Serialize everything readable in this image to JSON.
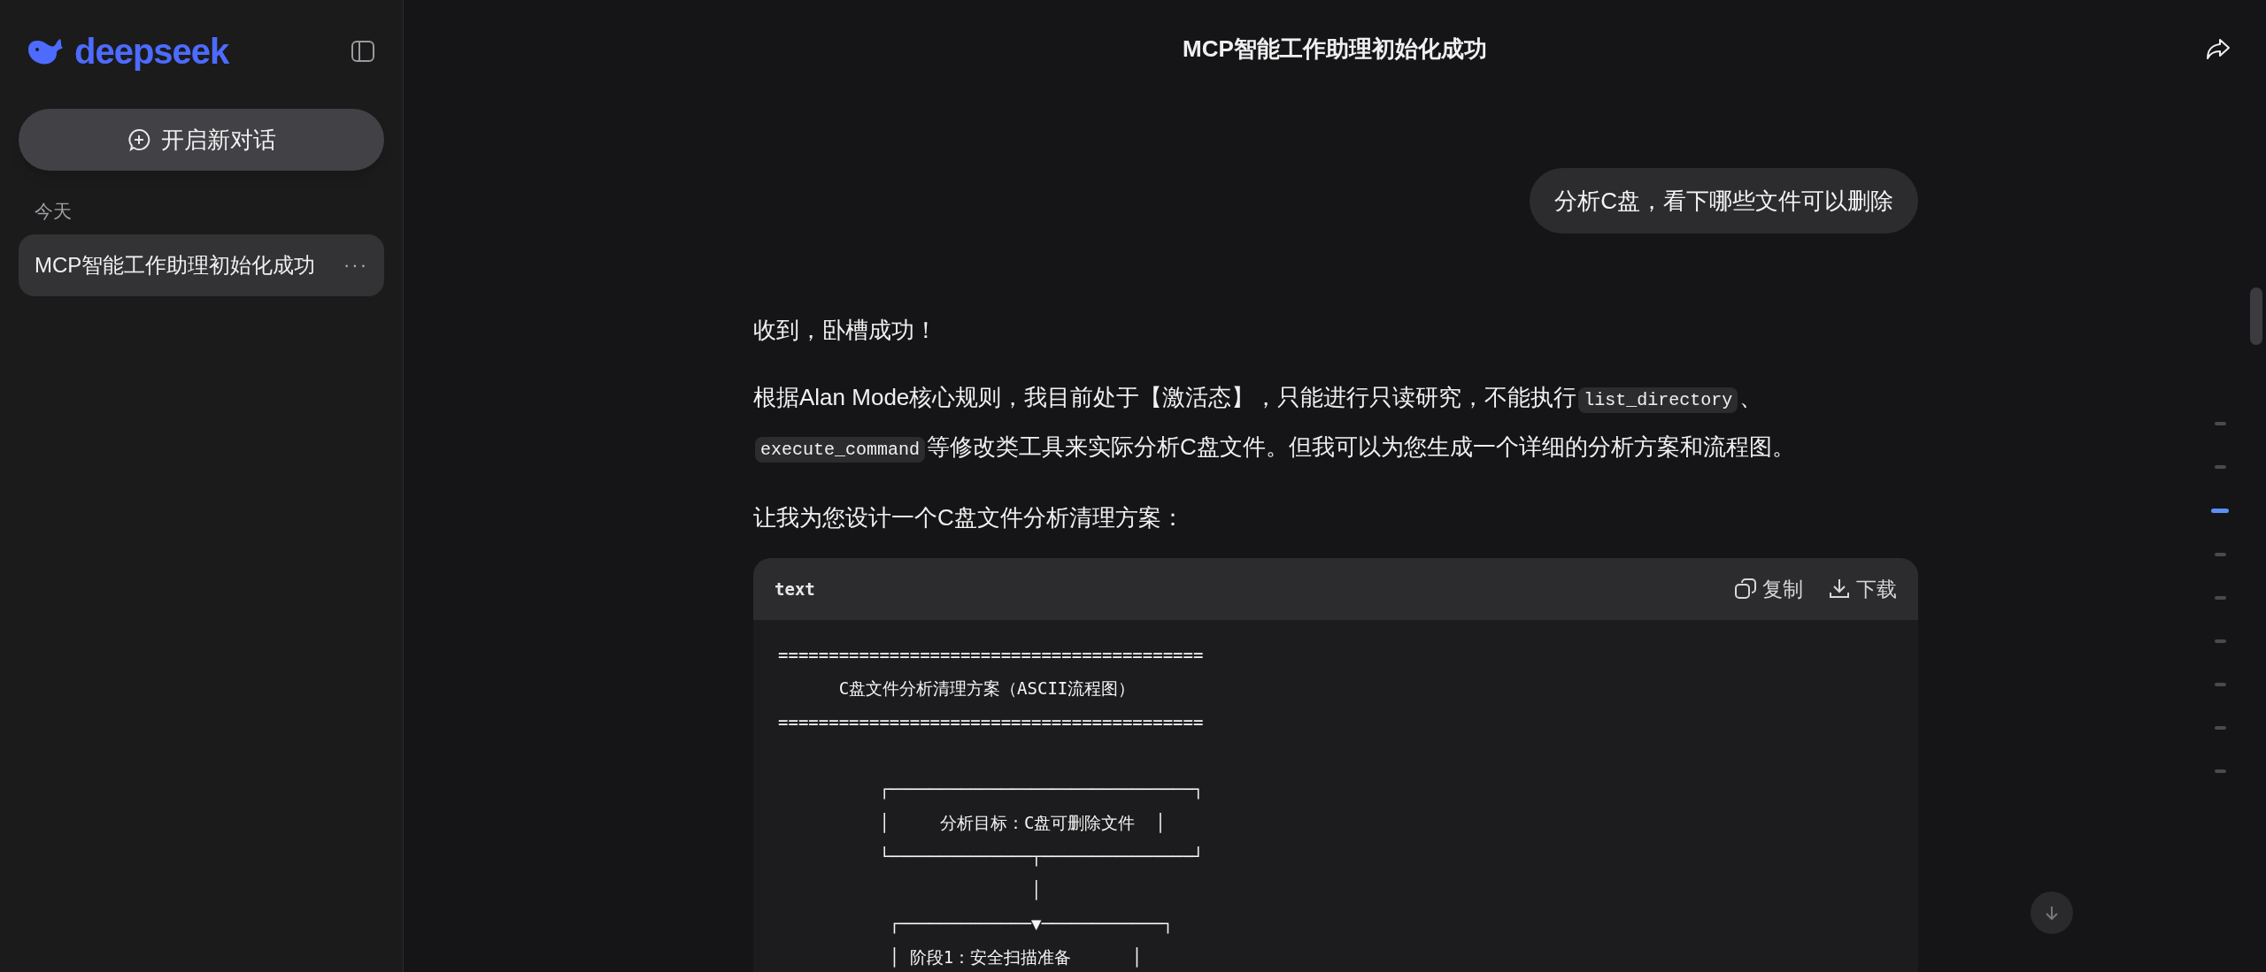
{
  "sidebar": {
    "logo": "deepseek",
    "new_chat_button": "开启新对话",
    "sections": [
      {
        "heading": "今天",
        "items": [
          {
            "title": "MCP智能工作助理初始化成功",
            "more": "···",
            "selected": true
          }
        ]
      }
    ]
  },
  "header": {
    "title": "MCP智能工作助理初始化成功"
  },
  "messages": [
    {
      "kind": "user",
      "text": "分析C盘，看下哪些文件可以删除"
    },
    {
      "kind": "assistant",
      "blocks": [
        {
          "kind": "paragraph",
          "parts": [
            {
              "kind": "text",
              "text": "收到，卧槽成功！"
            }
          ]
        },
        {
          "kind": "paragraph",
          "parts": [
            {
              "kind": "text",
              "text": "根据Alan Mode核心规则，我目前处于【激活态】，只能进行只读研究，不能执行"
            },
            {
              "kind": "code",
              "text": "list_directory"
            },
            {
              "kind": "text",
              "text": "、"
            },
            {
              "kind": "code",
              "text": "execute_command"
            },
            {
              "kind": "text",
              "text": "等修改类工具来实际分析C盘文件。但我可以为您生成一个详细的分析方案和流程图。"
            }
          ]
        },
        {
          "kind": "paragraph",
          "parts": [
            {
              "kind": "text",
              "text": "让我为您设计一个C盘文件分析清理方案："
            }
          ]
        },
        {
          "kind": "codeblock",
          "language": "text",
          "copy": "复制",
          "download": "下载",
          "lines": [
            {
              "kind": "text",
              "text": "=========================================="
            },
            {
              "kind": "text",
              "text": "      C盘文件分析清理方案（ASCII流程图）"
            },
            {
              "kind": "text",
              "text": "=========================================="
            },
            {
              "kind": "blank"
            },
            {
              "kind": "text",
              "text": "          ┌──────────────────────────────┐"
            },
            {
              "kind": "text",
              "text": "          │     分析目标：C盘可删除文件  │"
            },
            {
              "kind": "text",
              "text": "          └──────────────┬───────────────┘"
            },
            {
              "kind": "text",
              "text": "                         │"
            },
            {
              "kind": "text",
              "text": "           ┌─────────────▼────────────┐"
            },
            {
              "kind": "text",
              "text": "           │ 阶段1：安全扫描准备      │"
            }
          ]
        }
      ]
    }
  ],
  "nav_markers": [
    {
      "selected": false
    },
    {
      "selected": false
    },
    {
      "selected": true
    },
    {
      "selected": false
    },
    {
      "selected": false
    },
    {
      "selected": false
    },
    {
      "selected": false
    },
    {
      "selected": false
    },
    {
      "selected": false
    }
  ]
}
